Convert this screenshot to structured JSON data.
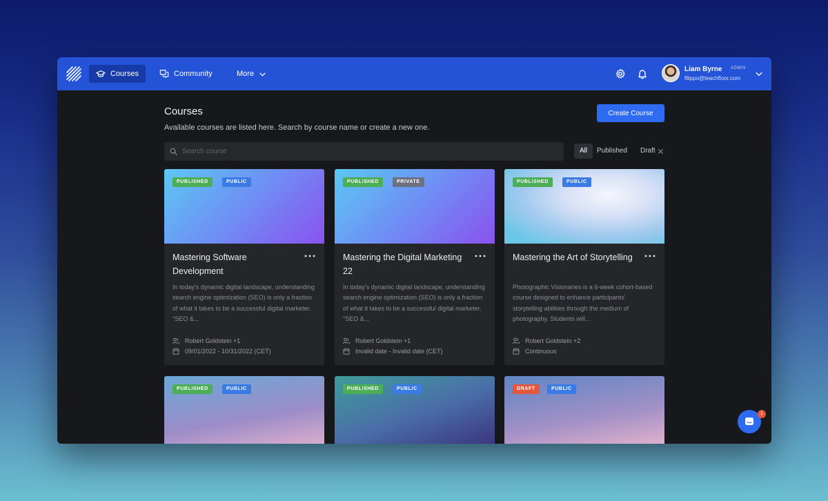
{
  "nav": {
    "items": [
      {
        "label": "Courses",
        "icon": "graduation-cap-icon"
      },
      {
        "label": "Community",
        "icon": "chat-bubbles-icon"
      },
      {
        "label": "More",
        "icon": "chevron-down-icon"
      }
    ]
  },
  "user": {
    "name": "Liam Byrne",
    "role": "ADMIN",
    "email": "filippo@teachfloor.com"
  },
  "page": {
    "title": "Courses",
    "subtitle": "Available courses are listed here. Search by course name or create a new one.",
    "create_label": "Create Course"
  },
  "search": {
    "placeholder": "Search course",
    "value": ""
  },
  "filters": [
    "All",
    "Published",
    "Draft"
  ],
  "courses": [
    {
      "status": "PUBLISHED",
      "visibility": "PUBLIC",
      "title": "Mastering Software Development",
      "description": "In today's dynamic digital landscape, understanding search engine optimization (SEO) is only a fraction of what it takes to be a successful digital marketer. \"SEO &...",
      "instructors": "Robert Goldstein +1",
      "dates": "09/01/2022 - 10/31/2022 (CET)"
    },
    {
      "status": "PUBLISHED",
      "visibility": "PRIVATE",
      "title": "Mastering the Digital Marketing 22",
      "description": "In today's dynamic digital landscape, understanding search engine optimization (SEO) is only a fraction of what it takes to be a successful digital marketer. \"SEO &...",
      "instructors": "Robert Goldstein +1",
      "dates": "Invalid date - Invalid date (CET)"
    },
    {
      "status": "PUBLISHED",
      "visibility": "PUBLIC",
      "title": "Mastering the Art of Storytelling",
      "description": "Photographic Visionaries is a 6-week cohort-based course designed to enhance participants' storytelling abilities through the medium of photography. Students will...",
      "instructors": "Robert Goldstein +2",
      "dates": "Continuous"
    },
    {
      "status": "PUBLISHED",
      "visibility": "PUBLIC"
    },
    {
      "status": "PUBLISHED",
      "visibility": "PUBLIC"
    },
    {
      "status": "DRAFT",
      "visibility": "PUBLIC"
    }
  ],
  "chat": {
    "unread_count": "1"
  },
  "colors": {
    "nav_bg": "#2453d8",
    "accent": "#2f6bf1",
    "published": "#4cae57",
    "public": "#3b7be5",
    "private": "#6b7180",
    "draft": "#e4573d"
  }
}
